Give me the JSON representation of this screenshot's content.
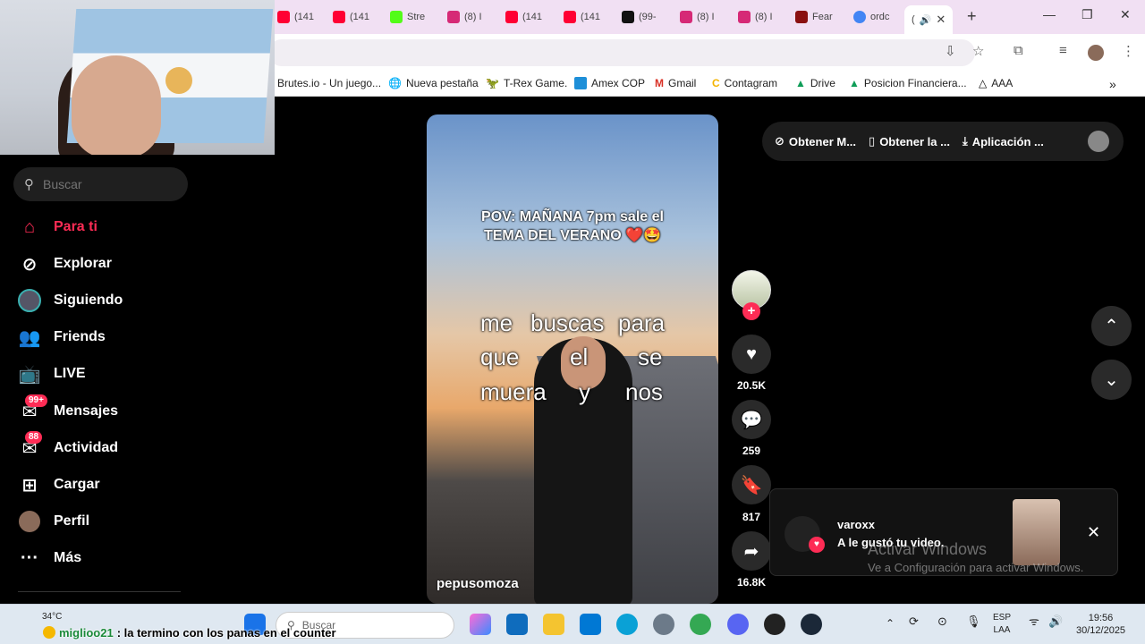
{
  "browser": {
    "tabs": [
      {
        "label": "(141",
        "icon": "youtube-icon",
        "color": "#ff0033"
      },
      {
        "label": "(141",
        "icon": "youtube-icon",
        "color": "#ff0033"
      },
      {
        "label": "Stre",
        "icon": "kick-icon",
        "color": "#53fc18"
      },
      {
        "label": "(8) I",
        "icon": "instagram-icon",
        "color": "#d62976"
      },
      {
        "label": "(141",
        "icon": "youtube-icon",
        "color": "#ff0033"
      },
      {
        "label": "(141",
        "icon": "youtube-icon",
        "color": "#ff0033"
      },
      {
        "label": "(99-",
        "icon": "tiktok-icon",
        "color": "#111111"
      },
      {
        "label": "(8) I",
        "icon": "instagram-icon",
        "color": "#d62976"
      },
      {
        "label": "(8) I",
        "icon": "instagram-icon",
        "color": "#d62976"
      },
      {
        "label": "Fear",
        "icon": "fear-icon",
        "color": "#8a1010"
      },
      {
        "label": "ordc",
        "icon": "google-icon",
        "color": "#4285f4"
      }
    ],
    "active_tab": {
      "label": "(",
      "icon": "tiktok-icon"
    },
    "bookmarks": [
      {
        "label": "Brutes.io - Un juego...",
        "icon": "brutes-icon"
      },
      {
        "label": "Nueva pestaña",
        "icon": "globe-icon"
      },
      {
        "label": "T-Rex Game.",
        "icon": "dino-icon"
      },
      {
        "label": "Amex COP",
        "icon": "amex-icon"
      },
      {
        "label": "Gmail",
        "icon": "gmail-icon"
      },
      {
        "label": "Contagram",
        "icon": "contagram-icon"
      },
      {
        "label": "Drive",
        "icon": "drive-icon"
      },
      {
        "label": "Posicion Financiera...",
        "icon": "drive-icon"
      },
      {
        "label": "AAA",
        "icon": "vercel-icon"
      }
    ]
  },
  "sidebar": {
    "search_placeholder": "Buscar",
    "items": [
      {
        "label": "Para ti",
        "icon": "home-icon",
        "active": true
      },
      {
        "label": "Explorar",
        "icon": "compass-icon"
      },
      {
        "label": "Siguiendo",
        "icon": "following-icon"
      },
      {
        "label": "Friends",
        "icon": "friends-icon"
      },
      {
        "label": "LIVE",
        "icon": "live-icon"
      },
      {
        "label": "Mensajes",
        "icon": "messages-icon",
        "badge": "99+"
      },
      {
        "label": "Actividad",
        "icon": "activity-icon",
        "badge": "88"
      },
      {
        "label": "Cargar",
        "icon": "upload-icon"
      },
      {
        "label": "Perfil",
        "icon": "profile-icon"
      },
      {
        "label": "Más",
        "icon": "more-icon"
      }
    ]
  },
  "video": {
    "caption_line1": "POV: MAÑANA 7pm sale el",
    "caption_line2": "TEMA DEL VERANO ❤️🤩",
    "lyrics": [
      "me",
      "buscas",
      "para",
      "que",
      "el",
      "se",
      "muera",
      "y",
      "nos"
    ],
    "username": "pepusomoza"
  },
  "actions": {
    "likes": "20.5K",
    "comments": "259",
    "saves": "817",
    "shares": "16.8K"
  },
  "topbar": {
    "item1": "Obtener M...",
    "item2": "Obtener la ...",
    "item3": "Aplicación ..."
  },
  "notification": {
    "user": "varoxx",
    "text": "A le gustó tu video."
  },
  "windows_watermark": {
    "line1": "Activar Windows",
    "line2": "Ve a Configuración para activar Windows."
  },
  "chat": {
    "user": "miglioo21",
    "message": ": la termino con los panas en el counter"
  },
  "taskbar": {
    "search_placeholder": "Buscar",
    "weather_temp": "34°C",
    "lang_line1": "ESP",
    "lang_line2": "LAA",
    "time": "19:56",
    "date": "30/12/2025"
  },
  "colors": {
    "accent": "#fe2c55",
    "background": "#000000"
  }
}
